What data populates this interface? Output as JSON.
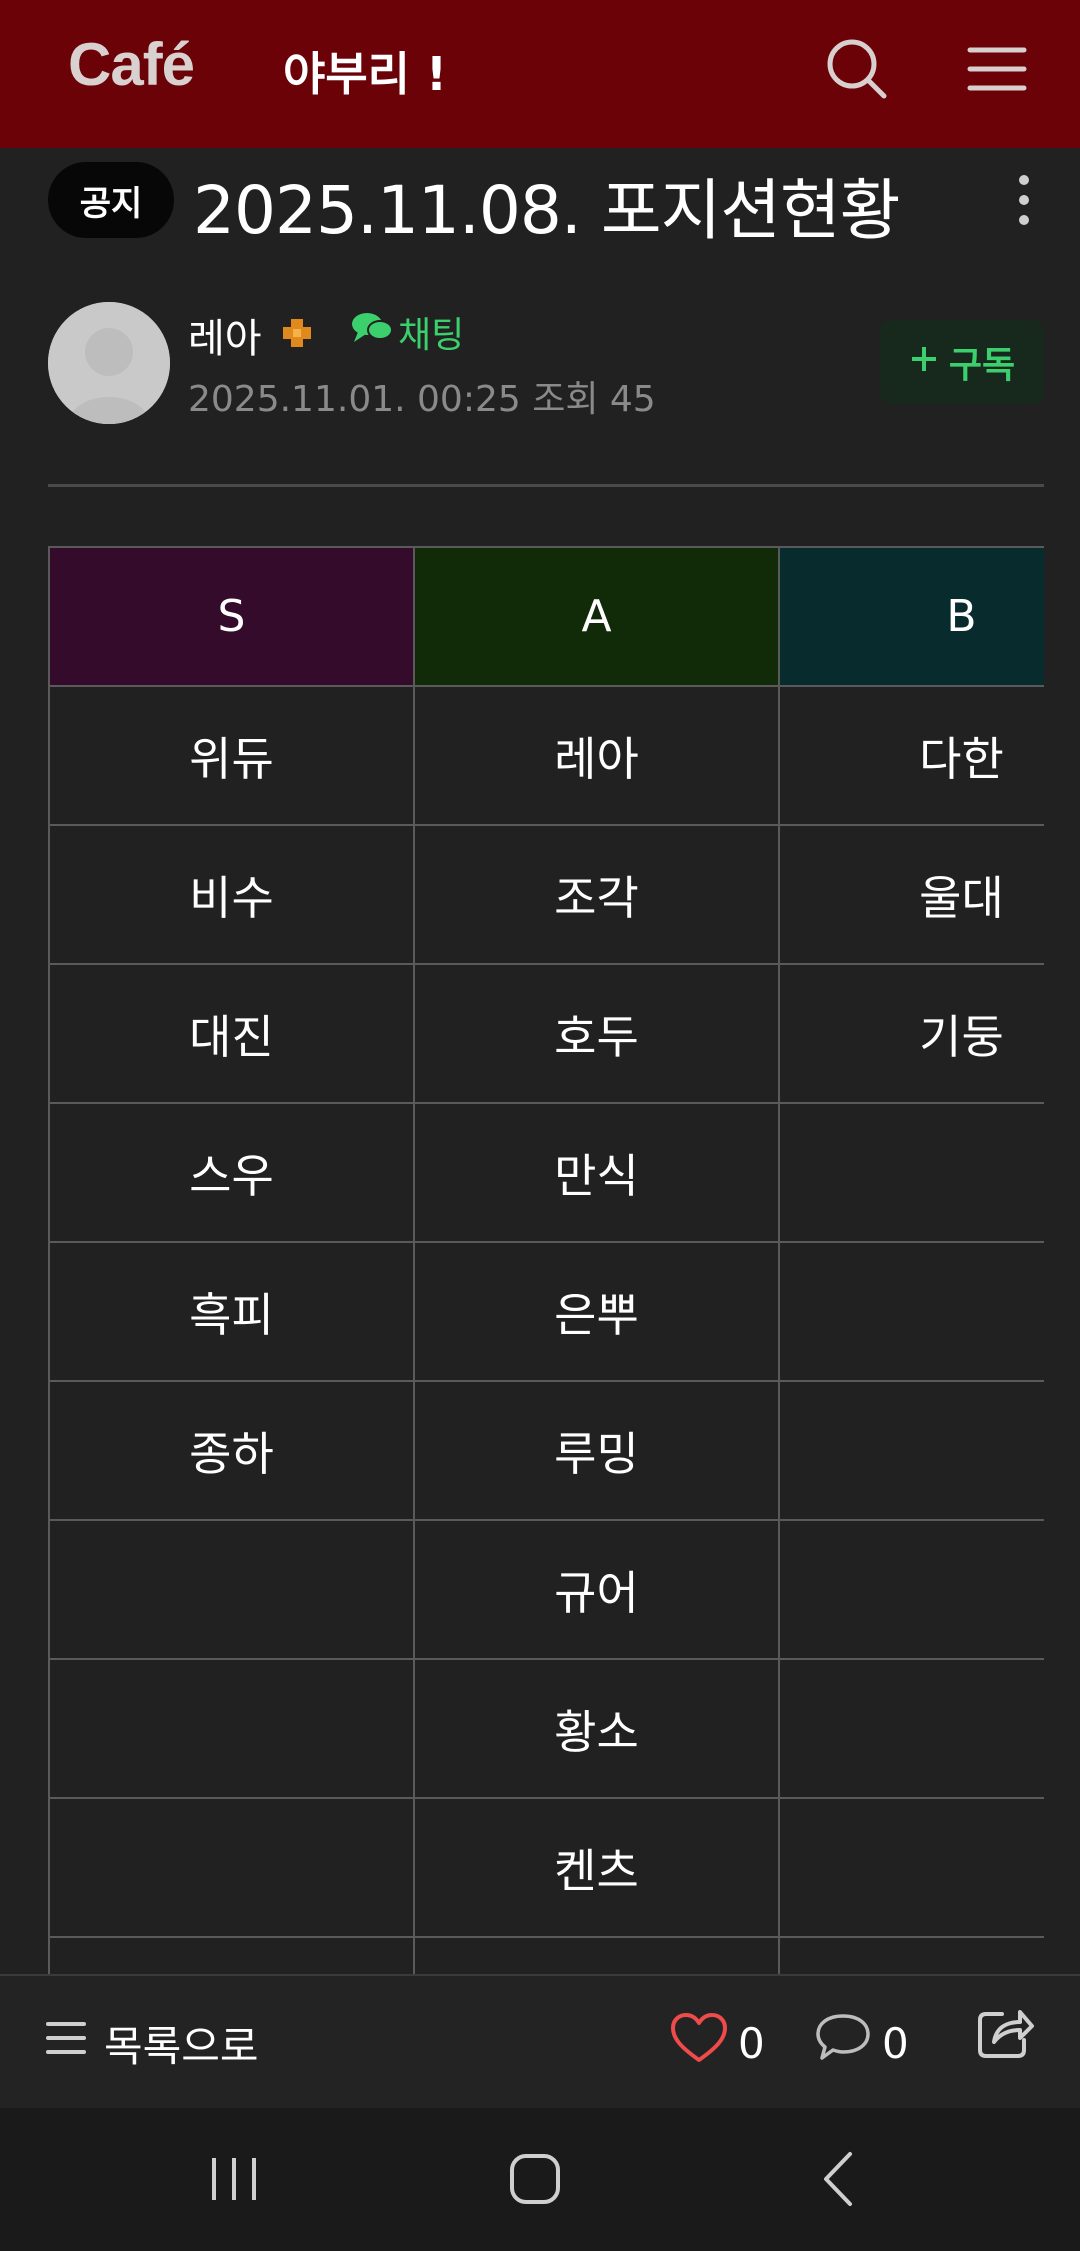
{
  "header": {
    "logo_text": "Café",
    "cafe_name": "야부리 !",
    "icons": [
      "search-icon",
      "menu-icon"
    ],
    "bg_color": "#6b0208"
  },
  "post": {
    "badge": "공지",
    "title": "2025.11.08. 포지션현황",
    "author": {
      "name": "레아",
      "chat_label": "채팅",
      "date": "2025.11.01. 00:25",
      "views": "조회 45"
    },
    "subscribe_label": "구독"
  },
  "table": {
    "headers": [
      "S",
      "A",
      "B"
    ],
    "header_colors": [
      "#340b2b",
      "#112a07",
      "#082c2d"
    ],
    "rows": [
      [
        "위듀",
        "레아",
        "다한"
      ],
      [
        "비수",
        "조각",
        "울대"
      ],
      [
        "대진",
        "호두",
        "기둥"
      ],
      [
        "스우",
        "만식",
        ""
      ],
      [
        "흑피",
        "은뿌",
        ""
      ],
      [
        "종하",
        "루밍",
        ""
      ],
      [
        "",
        "규어",
        ""
      ],
      [
        "",
        "황소",
        ""
      ],
      [
        "",
        "켄츠",
        ""
      ],
      [
        "",
        "",
        ""
      ]
    ]
  },
  "bottom_bar": {
    "list_label": "목록으로",
    "like_count": "0",
    "comment_count": "0"
  },
  "accent_color": "#3ccf6d"
}
